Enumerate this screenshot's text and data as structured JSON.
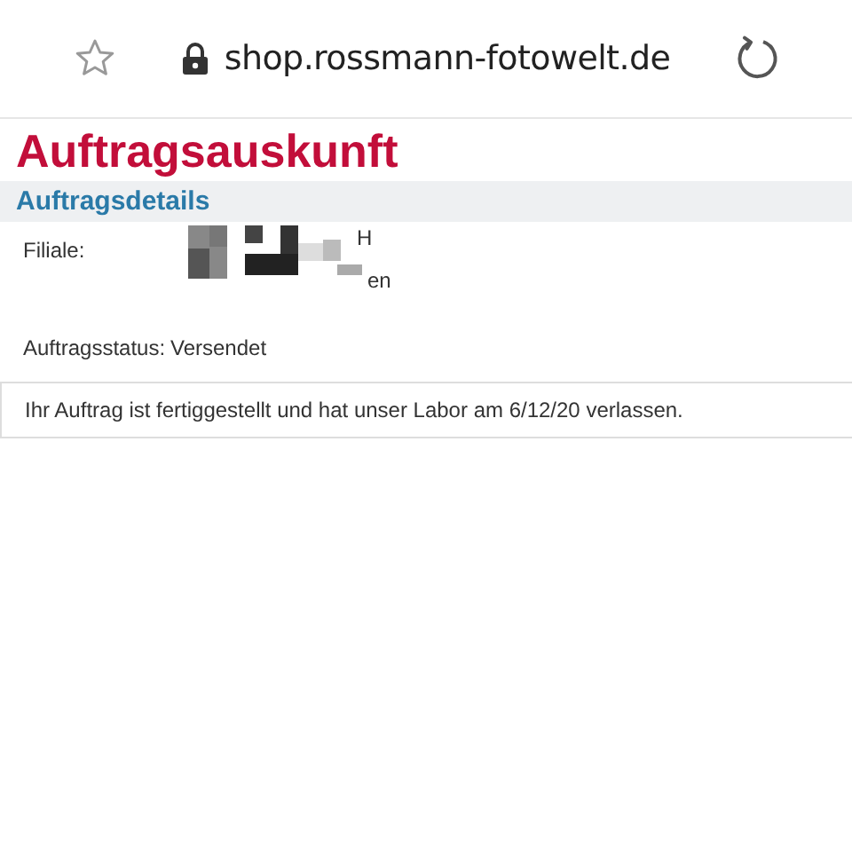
{
  "browser": {
    "url": "shop.rossmann-fotowelt.de"
  },
  "page": {
    "title": "Auftragsauskunft",
    "section": "Auftragsdetails",
    "details": [
      {
        "kind": "redacted",
        "label": "Filiale:",
        "fragments": [
          "H",
          "en"
        ]
      },
      {
        "kind": "text",
        "label": "Auftragsstatus:",
        "value": "Versendet"
      }
    ],
    "message": "Ihr Auftrag ist fertiggestellt und hat unser Labor am 6/12/20 verlassen."
  }
}
